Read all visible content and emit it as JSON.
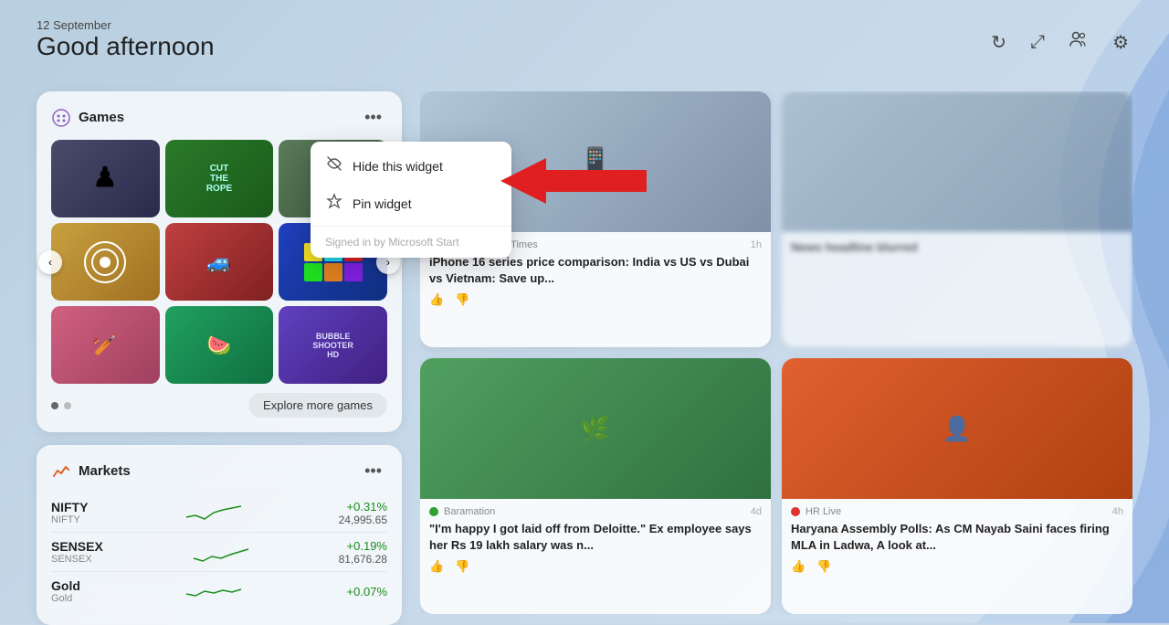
{
  "header": {
    "date": "12 September",
    "greeting": "Good afternoon"
  },
  "icons": {
    "refresh": "↻",
    "expand": "⤢",
    "people": "👥",
    "settings": "⚙"
  },
  "games_widget": {
    "title": "Games",
    "menu_dots": "···",
    "explore_label": "Explore more games",
    "games": [
      {
        "name": "Chess",
        "color_class": "chess"
      },
      {
        "name": "Cut the Rope",
        "color_class": "cut-rope"
      },
      {
        "name": "Car Race",
        "color_class": "car"
      },
      {
        "name": "Archery",
        "color_class": "archery"
      },
      {
        "name": "Monster Trucks",
        "color_class": "monster"
      },
      {
        "name": "Tetris",
        "color_class": "tetris"
      },
      {
        "name": "Cricket",
        "color_class": "cricket"
      },
      {
        "name": "Fruit Ninja",
        "color_class": "fruit"
      },
      {
        "name": "Bubble Shooter",
        "color_class": "bubble"
      }
    ]
  },
  "markets_widget": {
    "title": "Markets",
    "stocks": [
      {
        "ticker": "NIFTY",
        "sub": "NIFTY",
        "change": "+0.31%",
        "price": "24,995.65",
        "positive": true
      },
      {
        "ticker": "SENSEX",
        "sub": "SENSEX",
        "change": "+0.19%",
        "price": "81,676.28",
        "positive": true
      },
      {
        "ticker": "Gold",
        "sub": "Gold",
        "change": "+0.07%",
        "price": "",
        "positive": true
      }
    ]
  },
  "context_menu": {
    "item1_label": "Hide this widget",
    "item2_label": "Pin widget",
    "footer_label": "Signed in by Microsoft Start"
  },
  "news": [
    {
      "source": "The Economic Times",
      "source_color": "#e03030",
      "time": "1h",
      "headline": "iPhone 16 series price comparison: India vs US vs Dubai vs Vietnam: Save up...",
      "img_class": "news-img-iphone"
    },
    {
      "source": "Baramation",
      "source_color": "#30a030",
      "time": "4d",
      "headline": "\"I'm happy I got laid off from Deloitte.\" Ex employee says her Rs 19 lakh salary was n...",
      "img_class": "news-img-outdoor"
    },
    {
      "source": "HR Live",
      "source_color": "#e03030",
      "time": "4h",
      "headline": "Haryana Assembly Polls: As CM Nayab Saini faces firing MLA in Ladwa, A look at...",
      "img_class": "news-img-person"
    }
  ]
}
